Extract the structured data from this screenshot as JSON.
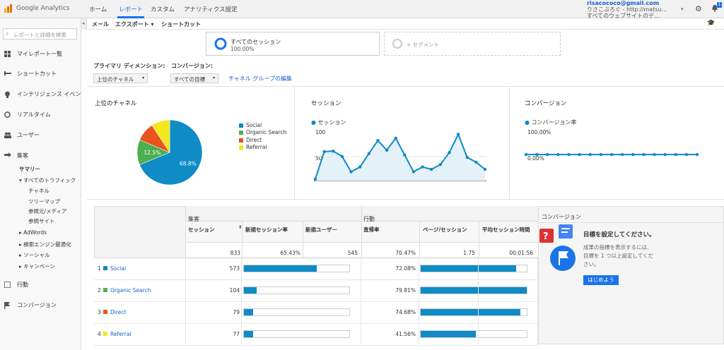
{
  "app": {
    "title": "Google Analytics"
  },
  "nav": {
    "home": "ホーム",
    "report": "レポート",
    "custom": "カスタム",
    "admin": "アナリティクス設定"
  },
  "account": {
    "email": "risacococo@gmail.com",
    "name": "りさこぶろぐ - http://matsu...",
    "view": "すべてのウェブサイトのデ..."
  },
  "sidebar": {
    "search_placeholder": "レポートと詳細を検索",
    "items": [
      {
        "label": "マイレポート一覧",
        "icon": "grid-icon"
      },
      {
        "label": "ショートカット",
        "icon": "shortcut-icon"
      },
      {
        "label": "インテリジェンス イベン",
        "icon": "bulb-icon"
      },
      {
        "label": "リアルタイム",
        "icon": "clock-icon"
      },
      {
        "label": "ユーザー",
        "icon": "users-icon"
      },
      {
        "label": "集客",
        "icon": "acquisition-icon"
      }
    ],
    "summary": "サマリー",
    "all_traffic": "▾ すべてのトラフィック",
    "sub": [
      "チャネル",
      "ツリーマップ",
      "参照元/メディア",
      "参照サイト"
    ],
    "more": [
      "▸ AdWords",
      "▸ 検索エンジン最適化",
      "▸ ソーシャル",
      "▸ キャンペーン"
    ],
    "behavior": "行動",
    "conversion": "コンバージョン"
  },
  "toolbar": {
    "email": "メール",
    "export": "エクスポート ▾",
    "shortcut": "ショートカット"
  },
  "segment": {
    "name": "すべてのセッション",
    "value": "100.00%",
    "add": "+ セグメント"
  },
  "dimension": {
    "label": "プライマリ ディメンション:",
    "value": "上位のチャネル",
    "conv_label": "コンバージョン:",
    "conv_value": "すべての目標",
    "edit_link": "チャネル グループの編集"
  },
  "panels": {
    "channels": "上位のチャネル",
    "sessions": "セッション",
    "conversions": "コンバージョン"
  },
  "legend": {
    "sessions": "セッション",
    "conv_rate": "コンバージョン率"
  },
  "colors": {
    "social": "#0f8bc6",
    "organic": "#4caf50",
    "direct": "#e8541e",
    "referral": "#f3e81b"
  },
  "chart_data": [
    {
      "type": "pie",
      "categories": [
        "Social",
        "Organic Search",
        "Direct",
        "Referral"
      ],
      "values": [
        68.8,
        12.5,
        9.5,
        9.2
      ],
      "labels": [
        "68.8%",
        "12.5%",
        "",
        ""
      ]
    },
    {
      "type": "area",
      "series": [
        {
          "name": "セッション",
          "values": [
            5,
            62,
            63,
            52,
            20,
            30,
            58,
            85,
            65,
            90,
            55,
            20,
            30,
            25,
            35,
            60,
            98,
            50,
            40,
            25
          ]
        }
      ],
      "ylim": [
        0,
        100
      ],
      "yticks": [
        "100",
        "50"
      ]
    },
    {
      "type": "line",
      "series": [
        {
          "name": "コンバージョン率",
          "values": [
            0,
            0,
            0,
            0,
            0,
            0,
            0,
            0,
            0,
            0,
            0,
            0,
            0,
            0,
            0,
            0,
            0
          ]
        }
      ],
      "yticks": [
        "100.00%",
        "0.00%"
      ]
    }
  ],
  "table": {
    "group1": "集客",
    "group2": "行動",
    "headers": {
      "sessions": "セッション",
      "new_rate": "新規セッション率",
      "new_users": "新規ユーザー",
      "bounce": "直帰率",
      "pages": "ページ/セッション",
      "duration": "平均セッション時間"
    },
    "totals": {
      "sessions": "833",
      "new_rate": "65.43%",
      "new_users": "545",
      "bounce": "70.47%",
      "pages": "1.75",
      "duration": "00:01:56"
    },
    "rows": [
      {
        "rank": "1",
        "name": "Social",
        "sessions": "573",
        "bounce": "72.08%",
        "new_frac": 0.69,
        "pages_frac": 0.9
      },
      {
        "rank": "2",
        "name": "Organic Search",
        "sessions": "104",
        "bounce": "79.81%",
        "new_frac": 0.12,
        "pages_frac": 1.0
      },
      {
        "rank": "3",
        "name": "Direct",
        "sessions": "79",
        "bounce": "74.68%",
        "new_frac": 0.09,
        "pages_frac": 0.94
      },
      {
        "rank": "4",
        "name": "Referral",
        "sessions": "77",
        "bounce": "41.56%",
        "new_frac": 0.09,
        "pages_frac": 0.52
      }
    ]
  },
  "conversion_panel": {
    "title": "コンバージョン",
    "heading": "目標を設定してください。",
    "desc1": "成果の指標を表示するには、",
    "desc2": "目標を 1 つ以上設定してくだ",
    "desc3": "さい。",
    "button": "はじめよう"
  }
}
